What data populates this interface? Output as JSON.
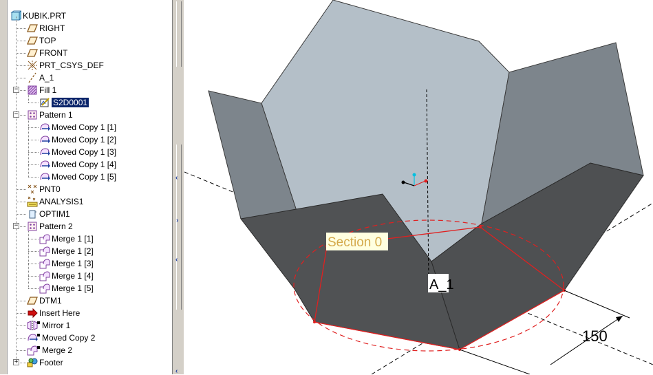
{
  "tree": {
    "root": {
      "label": "KUBIK.PRT",
      "icon": "part-icon"
    },
    "items": [
      {
        "label": "RIGHT",
        "icon": "datum-plane-icon",
        "indent": 1,
        "expander": ""
      },
      {
        "label": "TOP",
        "icon": "datum-plane-icon",
        "indent": 1,
        "expander": ""
      },
      {
        "label": "FRONT",
        "icon": "datum-plane-icon",
        "indent": 1,
        "expander": ""
      },
      {
        "label": "PRT_CSYS_DEF",
        "icon": "csys-icon",
        "indent": 1,
        "expander": ""
      },
      {
        "label": "A_1",
        "icon": "datum-axis-icon",
        "indent": 1,
        "expander": ""
      },
      {
        "label": "Fill 1",
        "icon": "fill-icon",
        "indent": 1,
        "expander": "−"
      },
      {
        "label": "S2D0001",
        "icon": "sketch-icon",
        "indent": 2,
        "expander": "",
        "selected": true
      },
      {
        "label": "Pattern 1",
        "icon": "pattern-icon",
        "indent": 1,
        "expander": "−"
      },
      {
        "label": "Moved Copy 1 [1]",
        "icon": "moved-copy-icon",
        "indent": 2,
        "expander": ""
      },
      {
        "label": "Moved Copy 1 [2]",
        "icon": "moved-copy-icon",
        "indent": 2,
        "expander": ""
      },
      {
        "label": "Moved Copy 1 [3]",
        "icon": "moved-copy-icon",
        "indent": 2,
        "expander": ""
      },
      {
        "label": "Moved Copy 1 [4]",
        "icon": "moved-copy-icon",
        "indent": 2,
        "expander": ""
      },
      {
        "label": "Moved Copy 1 [5]",
        "icon": "moved-copy-icon",
        "indent": 2,
        "expander": ""
      },
      {
        "label": "PNT0",
        "icon": "datum-point-icon",
        "indent": 1,
        "expander": ""
      },
      {
        "label": "ANALYSIS1",
        "icon": "analysis-icon",
        "indent": 1,
        "expander": ""
      },
      {
        "label": "OPTIM1",
        "icon": "optim-icon",
        "indent": 1,
        "expander": ""
      },
      {
        "label": "Pattern 2",
        "icon": "pattern-icon",
        "indent": 1,
        "expander": "−"
      },
      {
        "label": "Merge 1 [1]",
        "icon": "merge-icon",
        "indent": 2,
        "expander": ""
      },
      {
        "label": "Merge 1 [2]",
        "icon": "merge-icon",
        "indent": 2,
        "expander": ""
      },
      {
        "label": "Merge 1 [3]",
        "icon": "merge-icon",
        "indent": 2,
        "expander": ""
      },
      {
        "label": "Merge 1 [4]",
        "icon": "merge-icon",
        "indent": 2,
        "expander": ""
      },
      {
        "label": "Merge 1 [5]",
        "icon": "merge-icon",
        "indent": 2,
        "expander": ""
      },
      {
        "label": "DTM1",
        "icon": "datum-plane-icon",
        "indent": 1,
        "expander": ""
      },
      {
        "label": "Insert Here",
        "icon": "insert-here-icon",
        "indent": 1,
        "expander": ""
      },
      {
        "label": "Mirror 1",
        "icon": "mirror-icon",
        "indent": 1,
        "expander": "",
        "suppressed": true
      },
      {
        "label": "Moved Copy 2",
        "icon": "moved-copy-icon",
        "indent": 1,
        "expander": "",
        "suppressed": true
      },
      {
        "label": "Merge 2",
        "icon": "merge-icon",
        "indent": 1,
        "expander": "",
        "suppressed": true
      },
      {
        "label": "Footer",
        "icon": "footer-icon",
        "indent": 1,
        "expander": "+"
      }
    ]
  },
  "viewport": {
    "section_label": "Section 0",
    "axis_label": "A_1",
    "dimension_value": "150"
  },
  "colors": {
    "selection": "#0a246a",
    "sketch_red": "#e02020",
    "face_light": "#b4bfc8",
    "face_mid": "#7d858c",
    "face_dark": "#505254",
    "label_bg": "#ffffe0",
    "label_text": "#d4a94a"
  }
}
